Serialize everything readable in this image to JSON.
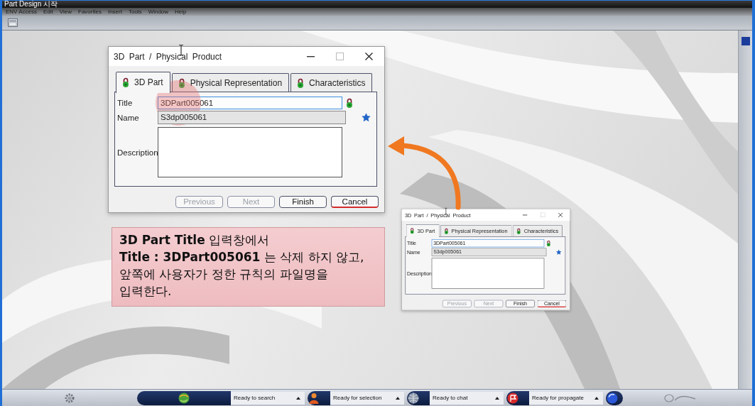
{
  "app": {
    "title": "Part Design 시작",
    "menu": [
      "ENV Access",
      "Edit",
      "View",
      "Favorites",
      "Insert",
      "Tools",
      "Window",
      "Help"
    ]
  },
  "dialogs": [
    {
      "kind": "window",
      "title": "3D Part / Physical Product",
      "tabs": [
        {
          "label": "3D Part",
          "selected": true
        },
        {
          "label": "Physical Representation",
          "selected": false
        },
        {
          "label": "Characteristics",
          "selected": false
        }
      ],
      "fields": [
        {
          "kind": "text",
          "label": "Title",
          "value": "3DPart005061",
          "focused": true,
          "locked": true,
          "starred": false,
          "highlighted": true
        },
        {
          "kind": "readonly",
          "label": "Name",
          "value": "S3dp005061",
          "focused": false,
          "locked": false,
          "starred": true,
          "highlighted": false
        },
        {
          "kind": "textarea",
          "label": "Description",
          "focused": false,
          "locked": false,
          "starred": false,
          "highlighted": false
        }
      ],
      "buttons": [
        {
          "label": "Previous",
          "disabled": true,
          "focused": false
        },
        {
          "label": "Next",
          "disabled": true,
          "focused": false
        },
        {
          "label": "Finish",
          "disabled": false,
          "focused": false
        },
        {
          "label": "Cancel",
          "disabled": false,
          "focused": true
        }
      ]
    },
    {
      "kind": "thumbnail",
      "title": "3D Part / Physical Product",
      "tabs": [
        {
          "label": "3D Part",
          "selected": true
        },
        {
          "label": "Physical Representation",
          "selected": false
        },
        {
          "label": "Characteristics",
          "selected": false
        }
      ],
      "fields": [
        {
          "kind": "text",
          "label": "Title",
          "value": "3DPart005061",
          "focused": true,
          "locked": true,
          "starred": false,
          "highlighted": false
        },
        {
          "kind": "readonly",
          "label": "Name",
          "value": "S3dp005061",
          "focused": false,
          "locked": false,
          "starred": true,
          "highlighted": false
        },
        {
          "kind": "textarea",
          "label": "Description",
          "focused": false,
          "locked": false,
          "starred": false,
          "highlighted": false
        }
      ],
      "buttons": [
        {
          "label": "Previous",
          "disabled": true,
          "focused": false
        },
        {
          "label": "Next",
          "disabled": true,
          "focused": false
        },
        {
          "label": "Finish",
          "disabled": false,
          "focused": false
        },
        {
          "label": "Cancel",
          "disabled": false,
          "focused": true
        }
      ]
    }
  ],
  "callout": {
    "text": "**3D Part Title** 입력창에서\n**Title : 3DPart005061** 는 삭제 하지 않고,\n앞쪽에 사용자가 정한 규칙의 파일명을\n입력한다."
  },
  "taskbar": {
    "statuses": [
      "Ready to search",
      "Ready for selection",
      "Ready to chat",
      "Ready for propagate"
    ]
  }
}
